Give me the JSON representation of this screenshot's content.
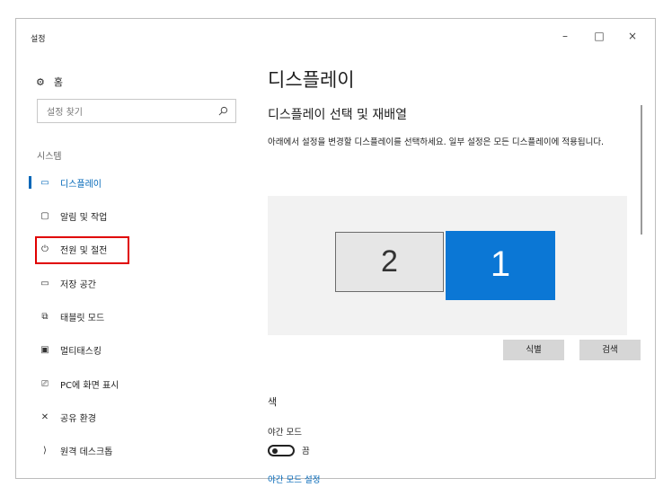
{
  "window": {
    "title": "설정",
    "minimize_label": "–",
    "maximize_label": "□",
    "close_label": "×"
  },
  "sidebar": {
    "home_icon": "gear-icon",
    "home_label": "홈",
    "search_placeholder": "설정 찾기",
    "category": "시스템",
    "items": [
      {
        "label": "디스플레이",
        "icon": "display-icon",
        "active": true
      },
      {
        "label": "알림 및 작업",
        "icon": "notification-icon"
      },
      {
        "label": "전원 및 절전",
        "icon": "power-icon",
        "highlighted": true
      },
      {
        "label": "저장 공간",
        "icon": "storage-icon"
      },
      {
        "label": "태블릿 모드",
        "icon": "tablet-icon"
      },
      {
        "label": "멀티태스킹",
        "icon": "multitasking-icon"
      },
      {
        "label": "PC에 화면 표시",
        "icon": "projecting-icon"
      },
      {
        "label": "공유 환경",
        "icon": "shared-icon"
      },
      {
        "label": "원격 데스크톱",
        "icon": "remote-desktop-icon"
      }
    ]
  },
  "main": {
    "title": "디스플레이",
    "subtitle": "디스플레이 선택 및 재배열",
    "description": "아래에서 설정을 변경할 디스플레이를 선택하세요. 일부 설정은 모든 디스플레이에 적용됩니다.",
    "monitors": [
      {
        "label": "2"
      },
      {
        "label": "1",
        "selected": true
      }
    ],
    "identify_label": "식별",
    "detect_label": "검색",
    "color_heading": "색",
    "night_mode_label": "야간 모드",
    "night_mode_state": "끔",
    "night_mode_link": "야간 모드 설정"
  },
  "colors": {
    "accent": "#0067b8",
    "selected_monitor": "#0b77d5",
    "highlight_box": "#e00000"
  }
}
